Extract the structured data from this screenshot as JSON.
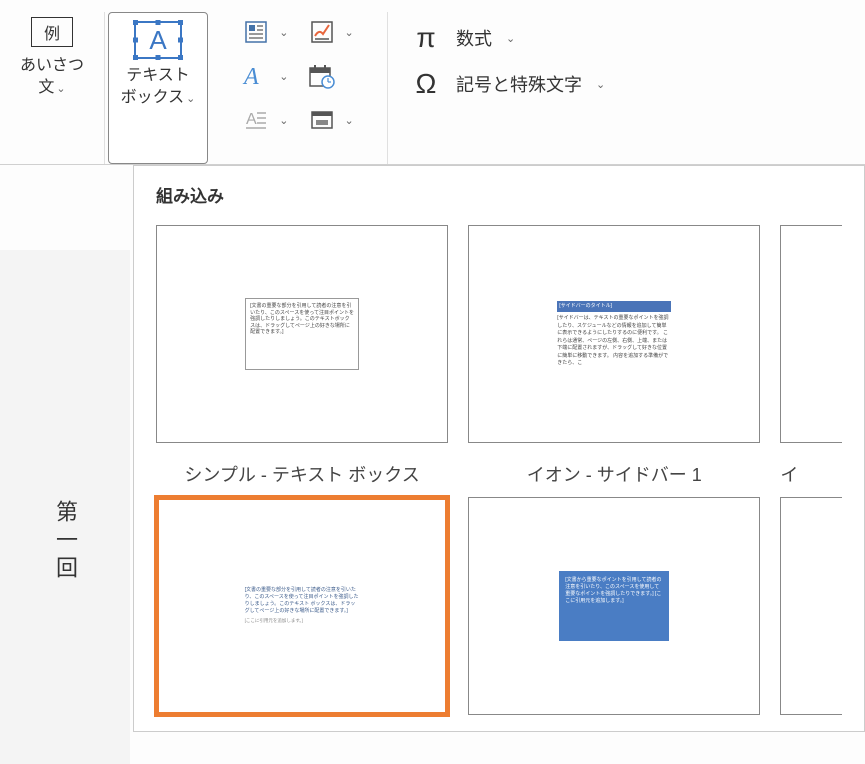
{
  "ribbon": {
    "aisatsu": {
      "icon_text": "例",
      "label": "あいさつ\n文"
    },
    "textbox": {
      "letter": "A",
      "label": "テキスト\nボックス"
    },
    "small_buttons": {
      "quickparts": "クイックパーツ",
      "signature": "署名欄",
      "wordart": "ワードアート",
      "datetime": "日付と時刻",
      "dropcap": "ドロップキャップ",
      "object": "オブジェクト"
    },
    "symbols": {
      "equation": {
        "label": "数式"
      },
      "symbol": {
        "label": "記号と特殊文字"
      }
    }
  },
  "dropdown": {
    "heading": "組み込み",
    "gallery": {
      "item1_preview": "[文書の重要な部分を引用して読者の注意を引いたり、このスペースを使って注目ポイントを強調したりしましょう。このテキストボックスは、ドラッグしてページ上の好きな場所に配置できます。]",
      "item2_header": "[サイドバーのタイトル]",
      "item2_preview": "[サイドバーは、テキストの重要なポイントを強調したり、スケジュールなどの情報を追加して簡単に表示できるようにしたりするのに便利です。\nこれらは通常、ページの左側、右側、上端、または下端に配置されますが、ドラッグして好きな位置に簡単に移動できます。\n内容を追加する準備ができたら、こ"
    },
    "labels": {
      "simple": "シンプル - テキスト ボックス",
      "ion_sidebar": "イオン - サイドバー 1",
      "ion_partial": "イ"
    },
    "gallery2": {
      "quote_preview": "[文書の重要な部分を引用して読者の注意を引いたり、このスペースを使って注目ポイントを強調したりしましょう。このテキスト ボックスは、ドラッグしてページ上の好きな場所に配置できます。]",
      "quote_sub": "[ここに引用元を追加します。]",
      "ion_preview": "[文書から重要なポイントを引用して読者の注意を引いたり、このスペースを使用して重要なポイントを強調したりできます。]\n[ここに引用元を追加します。]"
    }
  },
  "doc": {
    "heading": "第一回"
  }
}
